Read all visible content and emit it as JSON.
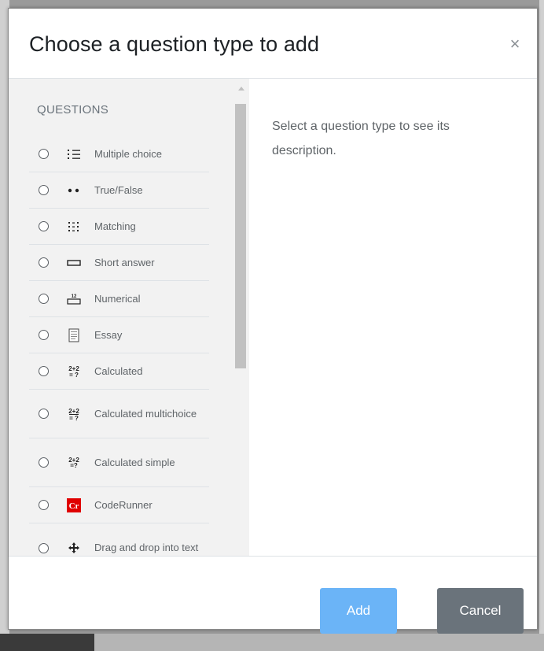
{
  "dialog": {
    "title": "Choose a question type to add",
    "close_symbol": "×"
  },
  "sidebar": {
    "section_label": "QUESTIONS",
    "items": [
      {
        "label": "Multiple choice",
        "icon": "multiple-choice-icon"
      },
      {
        "label": "True/False",
        "icon": "true-false-icon"
      },
      {
        "label": "Matching",
        "icon": "matching-icon"
      },
      {
        "label": "Short answer",
        "icon": "short-answer-icon"
      },
      {
        "label": "Numerical",
        "icon": "numerical-icon"
      },
      {
        "label": "Essay",
        "icon": "essay-icon"
      },
      {
        "label": "Calculated",
        "icon": "calculated-icon"
      },
      {
        "label": "Calculated multichoice",
        "icon": "calculated-multichoice-icon"
      },
      {
        "label": "Calculated simple",
        "icon": "calculated-simple-icon"
      },
      {
        "label": "CodeRunner",
        "icon": "coderunner-icon"
      },
      {
        "label": "Drag and drop into text",
        "icon": "drag-drop-icon"
      }
    ]
  },
  "description": {
    "text": "Select a question type to see its description."
  },
  "footer": {
    "add_label": "Add",
    "cancel_label": "Cancel"
  },
  "icon_text": {
    "calculated": "2+2\n= ?",
    "coderunner": "Cr",
    "numerical": "12"
  },
  "colors": {
    "add_button": "#6bb4f7",
    "cancel_button": "#6a737b",
    "coderunner_badge": "#e00000"
  }
}
